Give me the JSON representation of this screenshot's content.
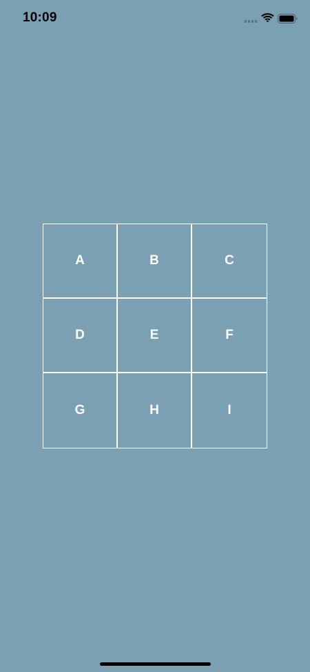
{
  "colors": {
    "background": "#7BA0B4",
    "grid_line": "#FFFFFF",
    "cell_text": "#FFFFFF",
    "status_text": "#000000"
  },
  "status_bar": {
    "time": "10:09",
    "icons": [
      "signal-icon",
      "wifi-icon",
      "battery-icon"
    ]
  },
  "grid": {
    "cells": [
      {
        "label": "A"
      },
      {
        "label": "B"
      },
      {
        "label": "C"
      },
      {
        "label": "D"
      },
      {
        "label": "E"
      },
      {
        "label": "F"
      },
      {
        "label": "G"
      },
      {
        "label": "H"
      },
      {
        "label": "I"
      }
    ]
  }
}
